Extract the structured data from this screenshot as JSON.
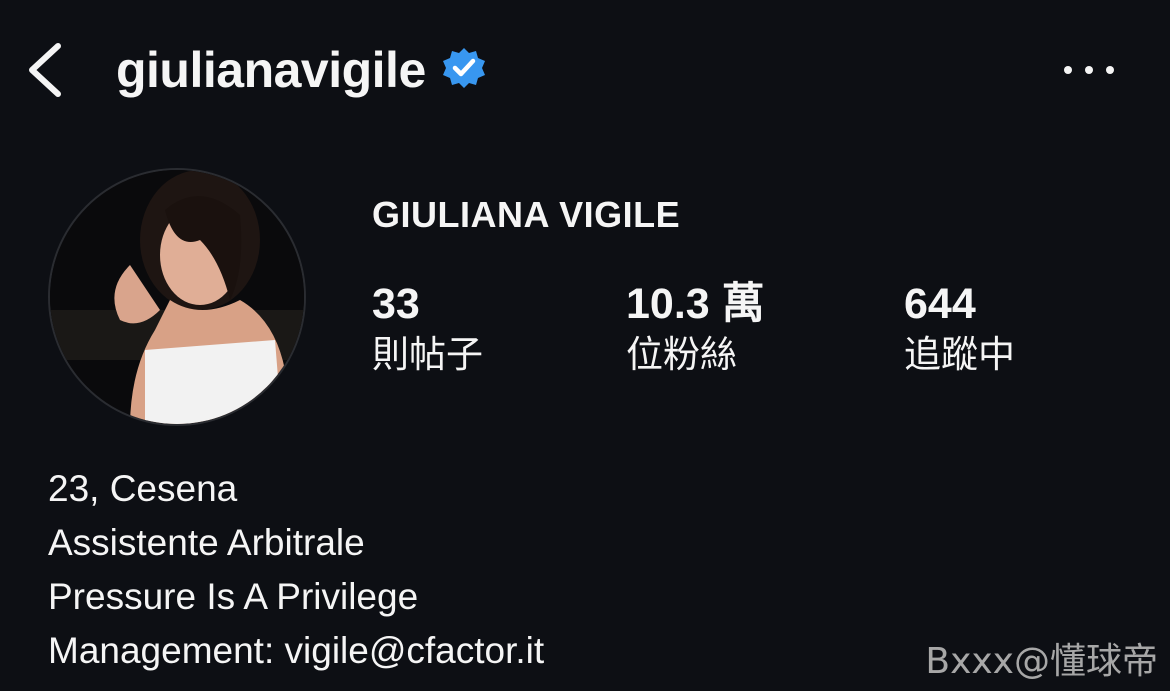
{
  "header": {
    "username": "giulianavigile",
    "verified": true
  },
  "profile": {
    "display_name": "GIULIANA VIGILE",
    "stats": [
      {
        "value": "33",
        "label": "則帖子"
      },
      {
        "value": "10.3 萬",
        "label": "位粉絲"
      },
      {
        "value": "644",
        "label": "追蹤中"
      }
    ],
    "bio": [
      "23, Cesena",
      "Assistente Arbitrale",
      "Pressure Is A Privilege",
      "Management: vigile@cfactor.it"
    ]
  },
  "watermark": "Bxxx@懂球帝",
  "colors": {
    "background": "#0d0f14",
    "text": "#f5f5f5",
    "verified_badge": "#3897f0"
  }
}
